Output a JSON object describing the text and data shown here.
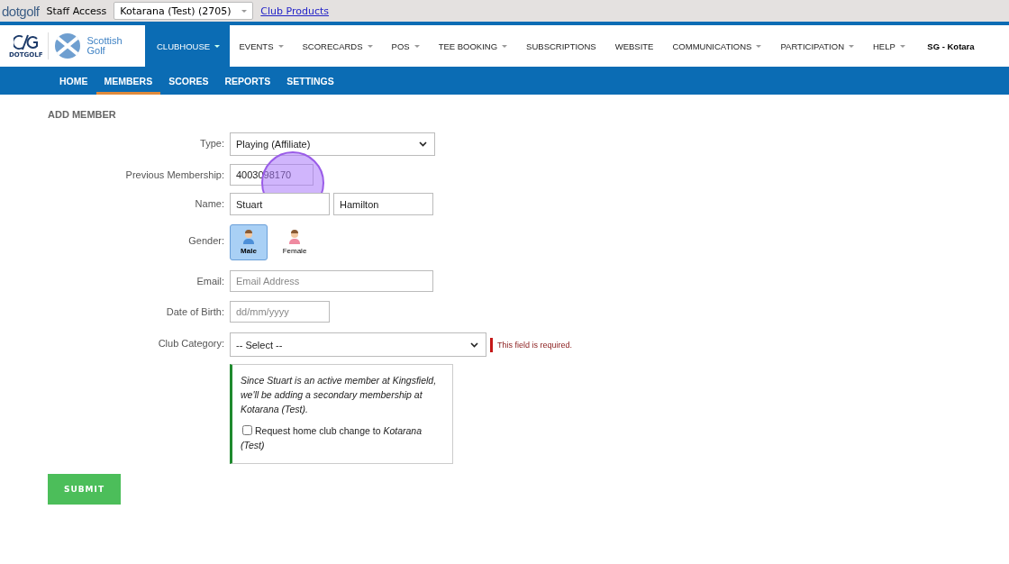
{
  "topbar": {
    "logo": "dotgolf",
    "label": "Staff Access",
    "club_select": "Kotarana (Test) (2705)",
    "link": "Club Products"
  },
  "brand": {
    "mark_caption": "DOTGOLF",
    "name_line1": "Scottish",
    "name_line2": "Golf"
  },
  "nav": [
    {
      "label": "CLUBHOUSE",
      "menu": true,
      "selected": true
    },
    {
      "label": "EVENTS",
      "menu": true,
      "selected": false
    },
    {
      "label": "SCORECARDS",
      "menu": true,
      "selected": false
    },
    {
      "label": "POS",
      "menu": true,
      "selected": false
    },
    {
      "label": "TEE BOOKING",
      "menu": true,
      "selected": false
    },
    {
      "label": "SUBSCRIPTIONS",
      "menu": false,
      "selected": false
    },
    {
      "label": "WEBSITE",
      "menu": false,
      "selected": false
    },
    {
      "label": "COMMUNICATIONS",
      "menu": true,
      "selected": false
    },
    {
      "label": "PARTICIPATION",
      "menu": true,
      "selected": false
    },
    {
      "label": "HELP",
      "menu": true,
      "selected": false
    }
  ],
  "user": "SG - Kotara",
  "subnav": [
    {
      "label": "HOME",
      "selected": false
    },
    {
      "label": "MEMBERS",
      "selected": true
    },
    {
      "label": "SCORES",
      "selected": false
    },
    {
      "label": "REPORTS",
      "selected": false
    },
    {
      "label": "SETTINGS",
      "selected": false
    }
  ],
  "page_title": "ADD MEMBER",
  "form": {
    "type": {
      "label": "Type:",
      "value": "Playing (Affiliate)"
    },
    "previous_membership": {
      "label": "Previous Membership:",
      "value": "4003098170"
    },
    "name": {
      "label": "Name:",
      "first": "Stuart",
      "last": "Hamilton"
    },
    "gender": {
      "label": "Gender:",
      "options": [
        {
          "label": "Male",
          "kind": "male",
          "selected": true
        },
        {
          "label": "Female",
          "kind": "female",
          "selected": false
        }
      ]
    },
    "email": {
      "label": "Email:",
      "placeholder": "Email Address"
    },
    "dob": {
      "label": "Date of Birth:",
      "placeholder": "dd/mm/yyyy"
    },
    "club_category": {
      "label": "Club Category:",
      "value": "-- Select --",
      "error": "This field is required."
    },
    "notice": {
      "text": "Since Stuart is an active member at Kingsfield, we'll be adding a secondary membership at Kotarana (Test).",
      "checkbox_label": "Request home club change to *Kotarana (Test)*",
      "checked": false
    },
    "submit": "SUBMIT"
  }
}
